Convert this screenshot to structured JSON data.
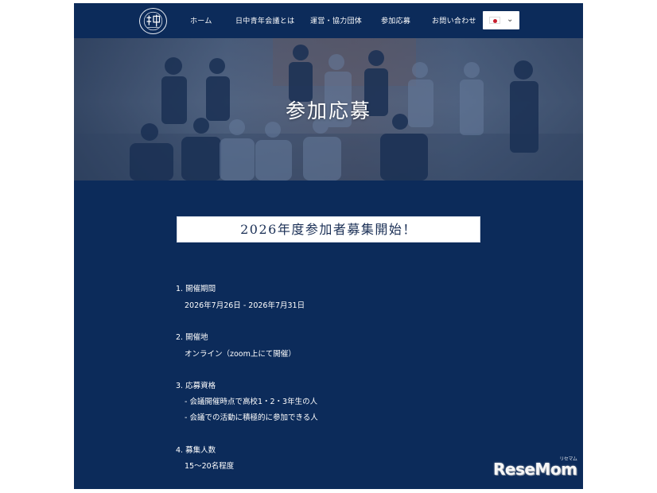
{
  "nav": {
    "items": [
      {
        "label": "ホーム"
      },
      {
        "label": "日中青年会議とは"
      },
      {
        "label": "運営・協力団体"
      },
      {
        "label": "参加応募"
      },
      {
        "label": "お問い合わせ"
      }
    ],
    "language": "Japanese (flag)"
  },
  "hero": {
    "title": "参加応募"
  },
  "banner": {
    "text": "2026年度参加者募集開始！"
  },
  "sections": [
    {
      "heading": "1. 開催期間",
      "lines": [
        "2026年7月26日 - 2026年7月31日"
      ]
    },
    {
      "heading": "2. 開催地",
      "lines": [
        "オンライン（zoom上にて開催）"
      ]
    },
    {
      "heading": "3. 応募資格",
      "lines": [
        "- 会議開催時点で高校1・2・3年生の人",
        "- 会議での活動に積極的に参加できる人"
      ]
    },
    {
      "heading": "4. 募集人数",
      "lines": [
        "15〜20名程度"
      ]
    }
  ],
  "watermark": {
    "text": "ReseMom",
    "small": "リセマム"
  },
  "colors": {
    "navy": "#0c2b5a",
    "white": "#ffffff",
    "flag_red": "#c81e2e"
  }
}
